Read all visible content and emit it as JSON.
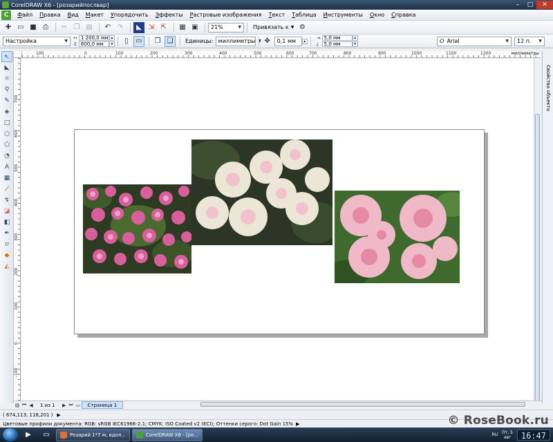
{
  "window": {
    "title": "CorelDRAW X6 - [розарийпослвар]"
  },
  "menu": {
    "logo": "C",
    "items": [
      "Файл",
      "Правка",
      "Вид",
      "Макет",
      "Упорядочить",
      "Эффекты",
      "Растровые изображения",
      "Текст",
      "Таблица",
      "Инструменты",
      "Окно",
      "Справка"
    ]
  },
  "toolbar": {
    "zoom_value": "21%",
    "snap_label": "Привязать к"
  },
  "propbar": {
    "preset_value": "Настройка",
    "width_value": "1 200,0 мм",
    "height_value": "600,0 мм",
    "units_label": "Единицы:",
    "units_value": "миллиметры",
    "nudge_value": "0,1 мм",
    "dup_x_value": "5,0 мм",
    "dup_y_value": "5,0 мм",
    "font_value": "Arial",
    "font_size_value": "12 п."
  },
  "rulers": {
    "unit": "миллиметры",
    "h_labels": [
      "100",
      "0",
      "100",
      "200",
      "300",
      "400",
      "500",
      "600",
      "700",
      "800",
      "900",
      "1000",
      "1100",
      "1200"
    ],
    "v_labels": [
      "700",
      "600",
      "500",
      "400",
      "300",
      "200",
      "100",
      "0",
      "-100"
    ]
  },
  "docker": {
    "tab_label": "Свойства объекта"
  },
  "pagenav": {
    "page_count": "1 из 1",
    "page_tab": "Страница 1"
  },
  "status": {
    "coordinates": "( 674,113; 118,201 )",
    "color_profiles": "Цветовые профили документа: RGB: sRGB IEC61966-2.1; CMYK: ISO Coated v2 (ECI); Оттенки серого: Dot Gain 15%"
  },
  "watermark": "© RoseBook.ru",
  "taskbar": {
    "tasks": [
      "Розарий 1*7 м, вдол...",
      "CorelDRAW X6 - [ро..."
    ],
    "lang": "RU",
    "date_line1": "Пт, 5",
    "date_line2": "авг",
    "clock": "16:47"
  },
  "colors": {
    "accent": "#4aa133",
    "title_bar": "#2b4360",
    "page_tab": "#cfe2f7"
  }
}
